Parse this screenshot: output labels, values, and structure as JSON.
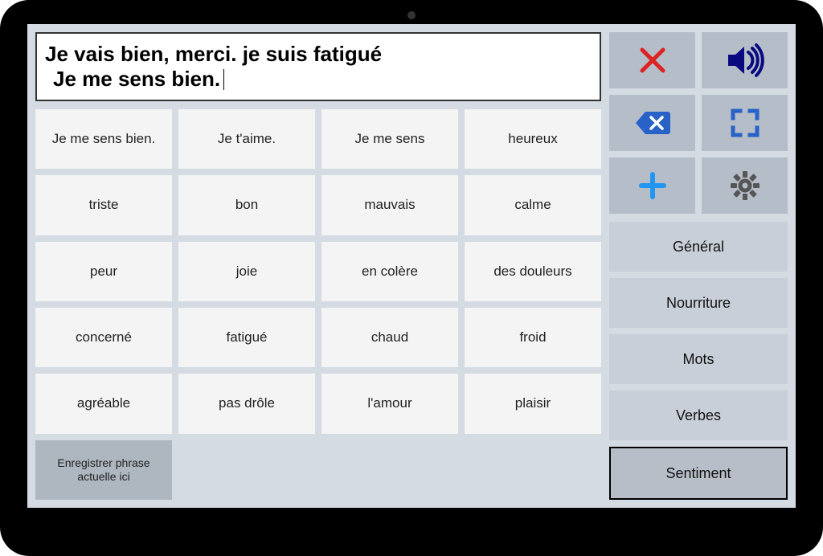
{
  "output": {
    "line1": "Je vais bien, merci. je suis fatigué",
    "line2": "Je me sens bien."
  },
  "words": [
    "Je me sens bien.",
    "Je t'aime.",
    "Je me sens",
    "heureux",
    "triste",
    "bon",
    "mauvais",
    "calme",
    "peur",
    "joie",
    "en colère",
    "des douleurs",
    "concerné",
    "fatigué",
    "chaud",
    "froid",
    "agréable",
    "pas drôle",
    "l'amour",
    "plaisir"
  ],
  "save_phrase": "Enregistrer phrase actuelle ici",
  "categories": [
    {
      "label": "Général",
      "active": false
    },
    {
      "label": "Nourriture",
      "active": false
    },
    {
      "label": "Mots",
      "active": false
    },
    {
      "label": "Verbes",
      "active": false
    },
    {
      "label": "Sentiment",
      "active": true
    }
  ],
  "icons": {
    "clear": "clear-icon",
    "speak": "speaker-icon",
    "backspace": "backspace-icon",
    "fullscreen": "fullscreen-icon",
    "add": "plus-icon",
    "settings": "gear-icon"
  }
}
